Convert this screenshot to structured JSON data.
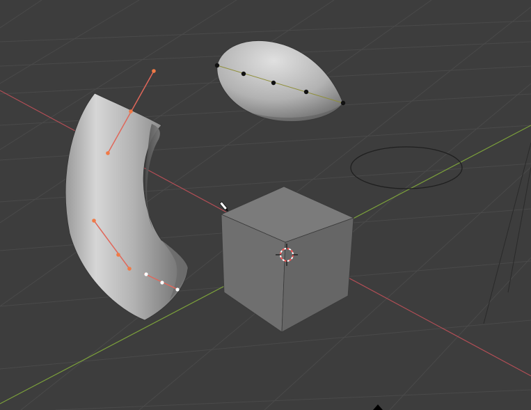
{
  "viewport": {
    "mode": "3d-viewport",
    "background_color": "#3d3d3d",
    "grid_color": "#4a4a4a",
    "x_axis_color": "#b34e56",
    "y_axis_color": "#7ca13b"
  },
  "scene": {
    "objects": [
      {
        "name": "curved-tube",
        "type": "curve",
        "color": "#b0b0b0",
        "handle_color": "#f07a46"
      },
      {
        "name": "ellipsoid",
        "type": "surface",
        "color": "#b8b8b8"
      },
      {
        "name": "cube",
        "type": "mesh",
        "color": "#6f6f6f"
      },
      {
        "name": "circle",
        "type": "curve",
        "color": "#1f1f1f"
      }
    ],
    "cursor": {
      "name": "3d-cursor",
      "colors": [
        "#ff5555",
        "#ffffff"
      ]
    },
    "tool_icon": "pencil-icon"
  }
}
